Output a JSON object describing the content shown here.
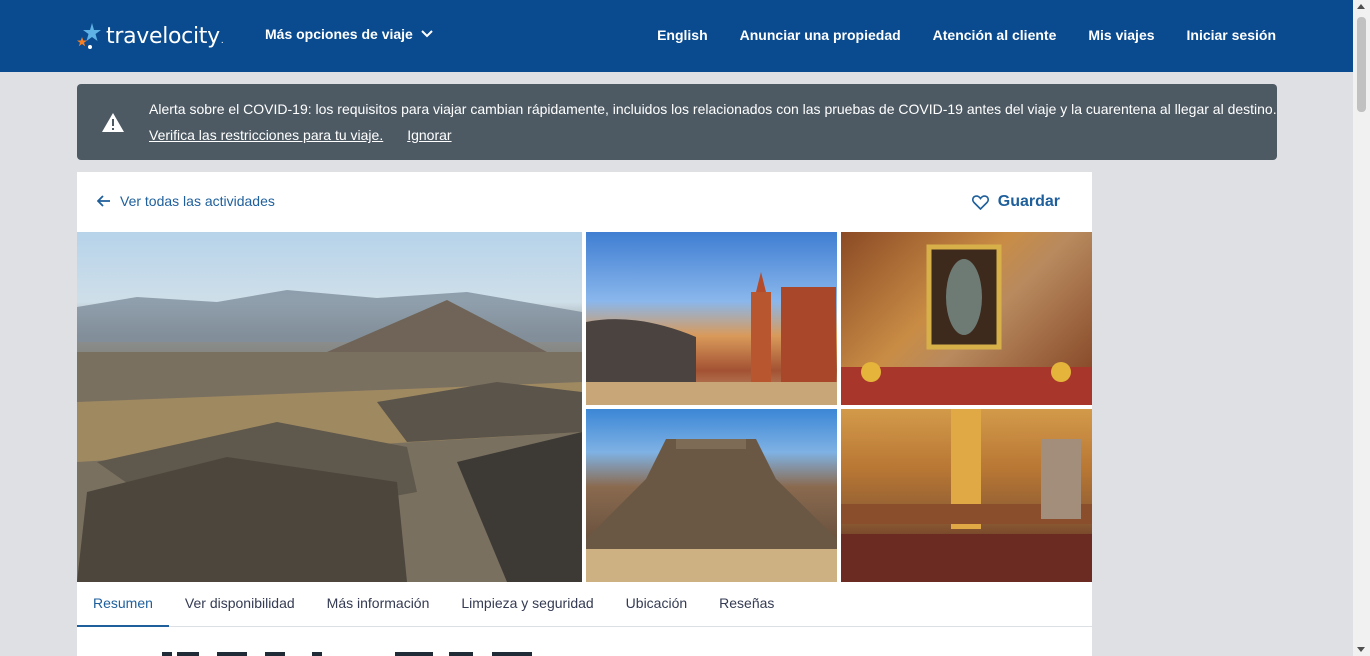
{
  "header": {
    "logo_text": "travelocity",
    "logo_suffix": ".",
    "more_options": "Más opciones de viaje",
    "nav": [
      "English",
      "Anunciar una propiedad",
      "Atención al cliente",
      "Mis viajes",
      "Iniciar sesión"
    ]
  },
  "alert": {
    "text": "Alerta sobre el COVID-19: los requisitos para viajar cambian rápidamente, incluidos los relacionados con las pruebas de COVID-19 antes del viaje y la cuarentena al llegar al destino.",
    "link_restrictions": "Verifica las restricciones para tu viaje.",
    "link_ignore": "Ignorar"
  },
  "card": {
    "back_link": "Ver todas las actividades",
    "save_label": "Guardar",
    "tabs": [
      "Resumen",
      "Ver disponibilidad",
      "Más información",
      "Limpieza y seguridad",
      "Ubicación",
      "Reseñas"
    ],
    "active_tab": "Resumen"
  },
  "colors": {
    "header_bg": "#0a4b8f",
    "alert_bg": "#4d5a64",
    "link": "#1e5f9c",
    "page_bg": "#dfe0e4"
  }
}
